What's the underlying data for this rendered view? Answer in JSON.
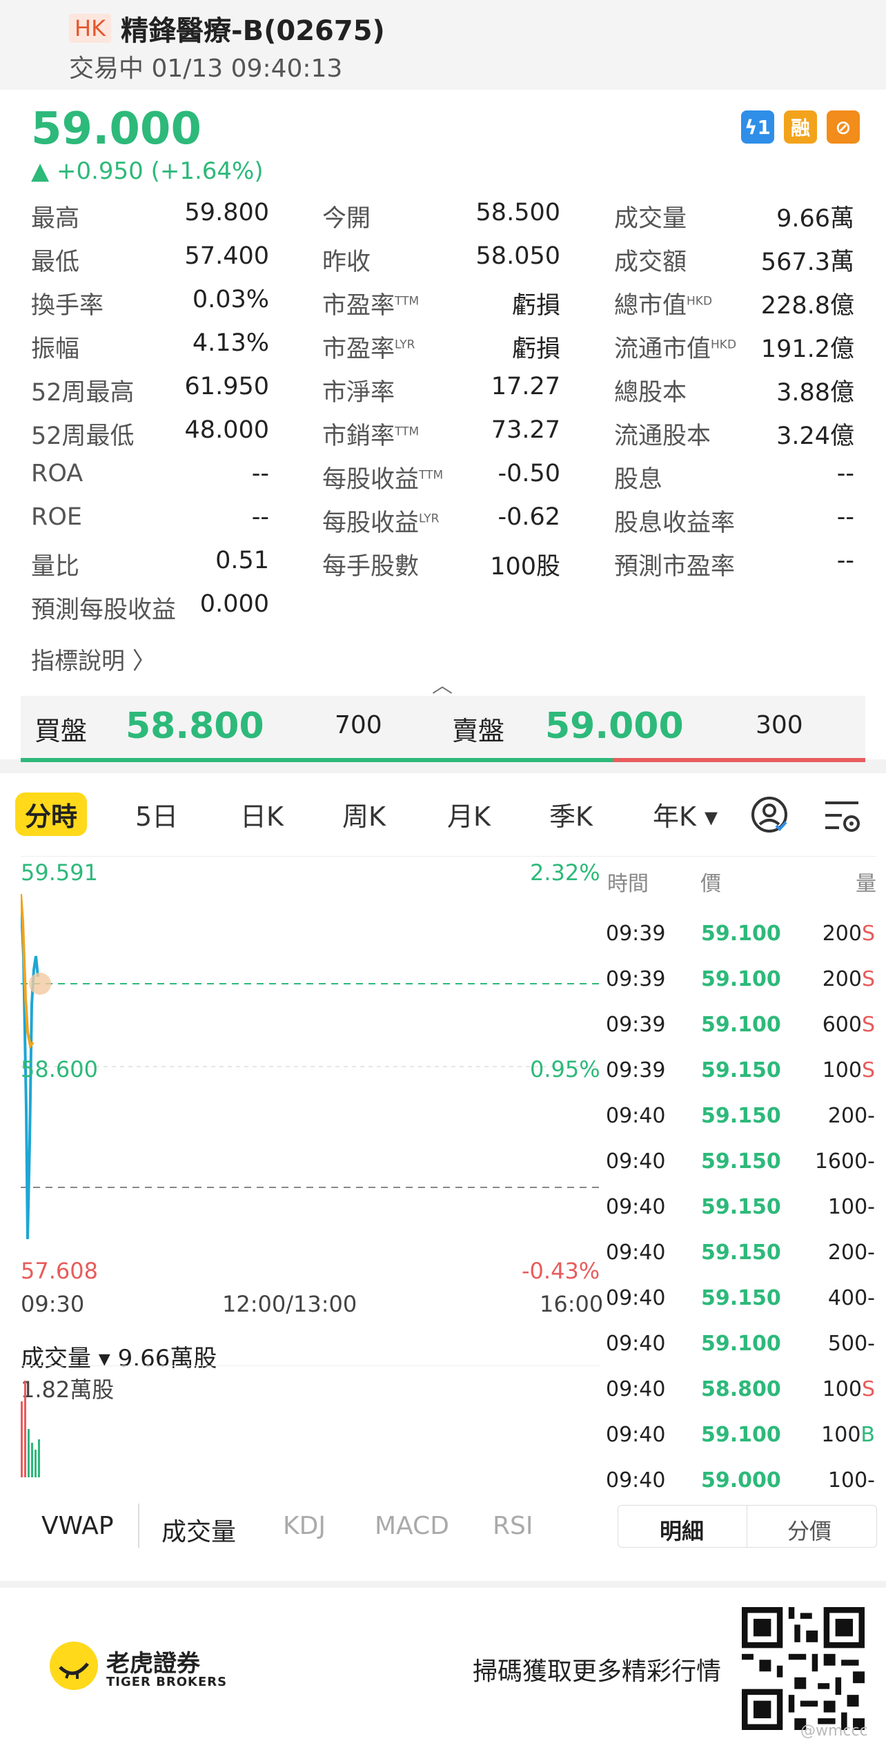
{
  "header": {
    "market": "HK",
    "title": "精鋒醫療-B(02675)",
    "status": "交易中 01/13 09:40:13"
  },
  "quote": {
    "price": "59.000",
    "change": "▲ +0.950 (+1.64%)"
  },
  "badges": [
    "ϟ1",
    "融",
    "⊘"
  ],
  "stats": [
    {
      "l": "最高",
      "v": "59.800"
    },
    {
      "l": "今開",
      "v": "58.500"
    },
    {
      "l": "成交量",
      "v": "9.66萬"
    },
    {
      "l": "最低",
      "v": "57.400"
    },
    {
      "l": "昨收",
      "v": "58.050"
    },
    {
      "l": "成交額",
      "v": "567.3萬"
    },
    {
      "l": "換手率",
      "v": "0.03%"
    },
    {
      "l": "市盈率",
      "sup": "TTM",
      "v": "虧損"
    },
    {
      "l": "總市值",
      "sup": "HKD",
      "v": "228.8億"
    },
    {
      "l": "振幅",
      "v": "4.13%"
    },
    {
      "l": "市盈率",
      "sup": "LYR",
      "v": "虧損"
    },
    {
      "l": "流通市值",
      "sup": "HKD",
      "v": "191.2億"
    },
    {
      "l": "52周最高",
      "v": "61.950"
    },
    {
      "l": "市淨率",
      "v": "17.27"
    },
    {
      "l": "總股本",
      "v": "3.88億"
    },
    {
      "l": "52周最低",
      "v": "48.000"
    },
    {
      "l": "市銷率",
      "sup": "TTM",
      "v": "73.27"
    },
    {
      "l": "流通股本",
      "v": "3.24億"
    },
    {
      "l": "ROA",
      "v": "--"
    },
    {
      "l": "每股收益",
      "sup": "TTM",
      "v": "-0.50"
    },
    {
      "l": "股息",
      "v": "--"
    },
    {
      "l": "ROE",
      "v": "--"
    },
    {
      "l": "每股收益",
      "sup": "LYR",
      "v": "-0.62"
    },
    {
      "l": "股息收益率",
      "v": "--"
    },
    {
      "l": "量比",
      "v": "0.51"
    },
    {
      "l": "每手股數",
      "v": "100股"
    },
    {
      "l": "預測市盈率",
      "v": "--"
    },
    {
      "l": "預測每股收益",
      "v": "0.000"
    }
  ],
  "explain": "指標說明 〉",
  "orderbook": {
    "bid_label": "買盤",
    "bid_price": "58.800",
    "bid_qty": "700",
    "ask_label": "賣盤",
    "ask_price": "59.000",
    "ask_qty": "300"
  },
  "tabs": [
    "分時",
    "5日",
    "日K",
    "周K",
    "月K",
    "季K",
    "年K ▾"
  ],
  "chart": {
    "y_top": "59.591",
    "y_mid": "58.600",
    "y_bot": "57.608",
    "pct_top": "2.32%",
    "pct_mid": "0.95%",
    "pct_bot": "-0.43%",
    "x_start": "09:30",
    "x_mid": "12:00/13:00",
    "x_end": "16:00"
  },
  "trades_head": {
    "time": "時間",
    "price": "價",
    "qty": "量"
  },
  "trades": [
    {
      "t": "09:39",
      "p": "59.100",
      "q": "200",
      "f": "S"
    },
    {
      "t": "09:39",
      "p": "59.100",
      "q": "200",
      "f": "S"
    },
    {
      "t": "09:39",
      "p": "59.100",
      "q": "600",
      "f": "S"
    },
    {
      "t": "09:39",
      "p": "59.150",
      "q": "100",
      "f": "S"
    },
    {
      "t": "09:40",
      "p": "59.150",
      "q": "200",
      "f": "-"
    },
    {
      "t": "09:40",
      "p": "59.150",
      "q": "1600",
      "f": "-"
    },
    {
      "t": "09:40",
      "p": "59.150",
      "q": "100",
      "f": "-"
    },
    {
      "t": "09:40",
      "p": "59.150",
      "q": "200",
      "f": "-"
    },
    {
      "t": "09:40",
      "p": "59.150",
      "q": "400",
      "f": "-"
    },
    {
      "t": "09:40",
      "p": "59.100",
      "q": "500",
      "f": "-"
    },
    {
      "t": "09:40",
      "p": "58.800",
      "q": "100",
      "f": "S"
    },
    {
      "t": "09:40",
      "p": "59.100",
      "q": "100",
      "f": "B"
    },
    {
      "t": "09:40",
      "p": "59.000",
      "q": "100",
      "f": "-"
    }
  ],
  "volume": {
    "label": "成交量 ▾ 9.66萬股",
    "max": "1.82萬股"
  },
  "indicators": [
    "VWAP",
    "成交量",
    "KDJ",
    "MACD",
    "RSI"
  ],
  "segment": [
    "明細",
    "分價"
  ],
  "footer": {
    "brand_cn": "老虎證券",
    "brand_en": "TIGER BROKERS",
    "scan": "掃碼獲取更多精彩行情",
    "watermark": "@wmccc"
  },
  "colors": {
    "up": "#2db97a",
    "down": "#e85c5c",
    "accent": "#ffd91a"
  }
}
